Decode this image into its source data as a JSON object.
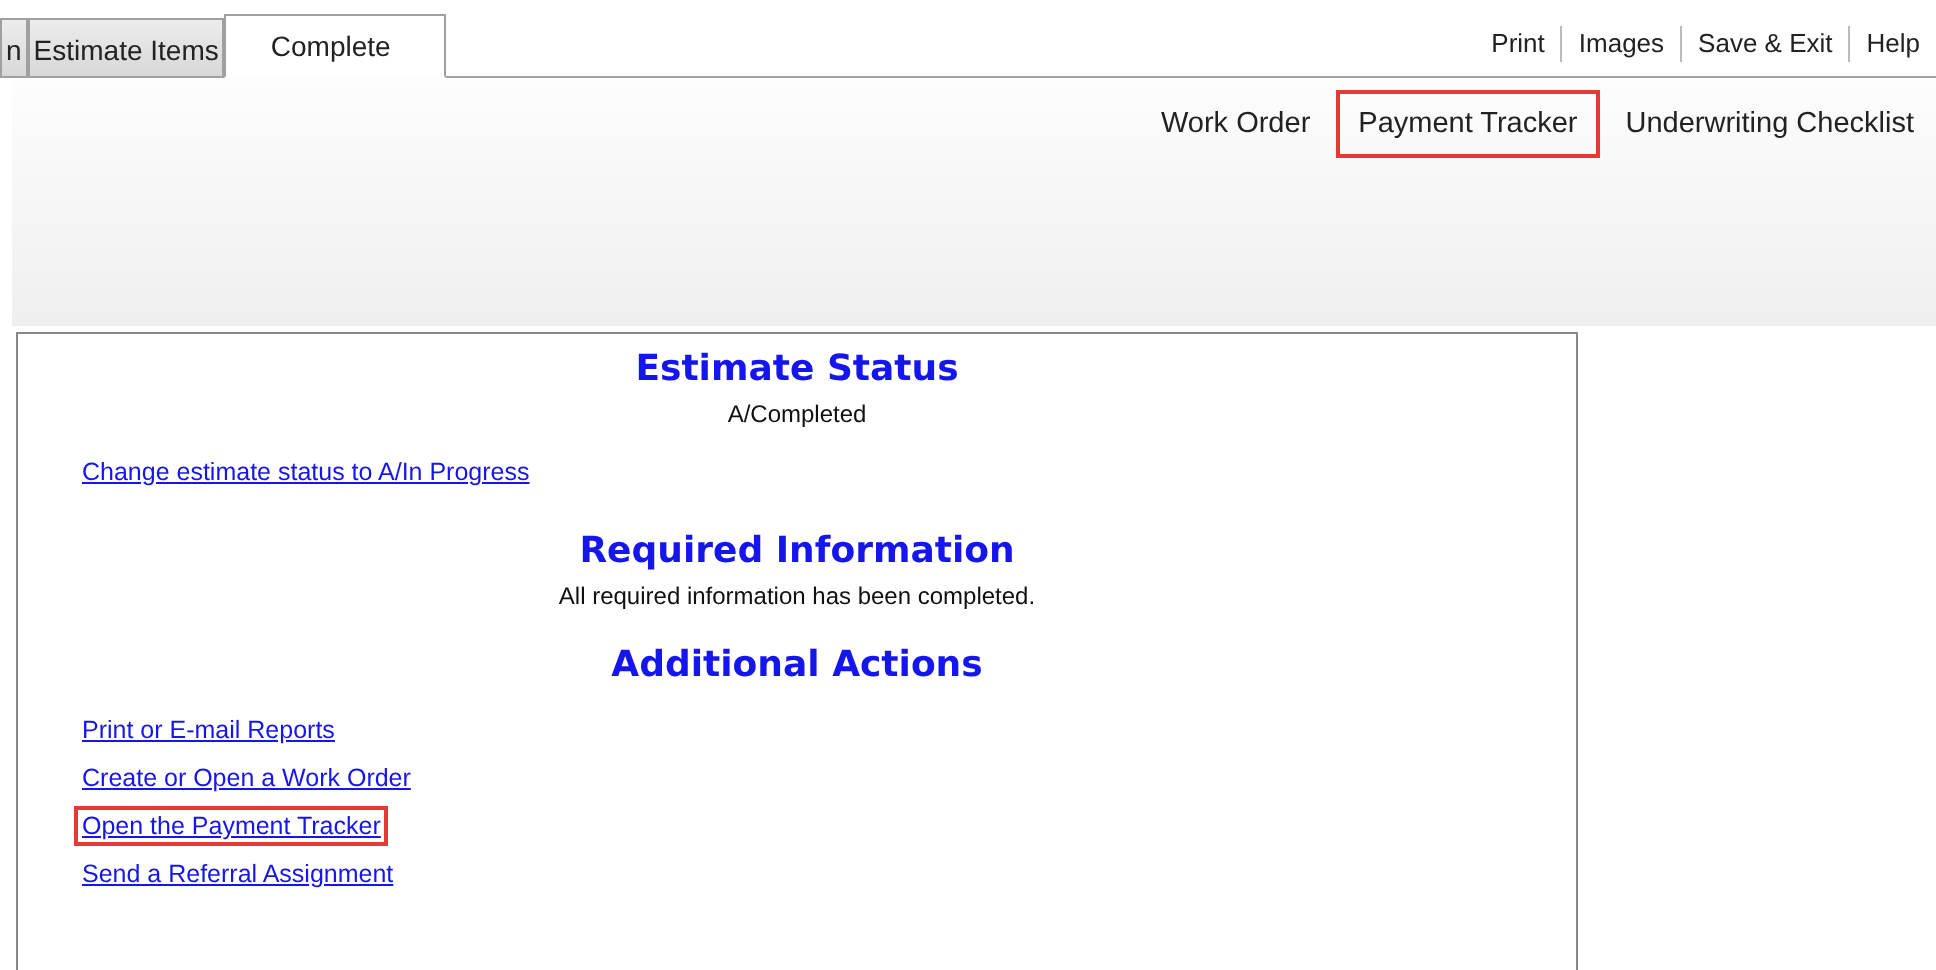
{
  "tabs": [
    {
      "label": "n",
      "selected": false
    },
    {
      "label": "Estimate Items",
      "selected": false
    },
    {
      "label": "Complete",
      "selected": true
    }
  ],
  "top_links": [
    "Print",
    "Images",
    "Save & Exit",
    "Help"
  ],
  "sub_links": [
    {
      "label": "Work Order",
      "highlighted": false
    },
    {
      "label": "Payment Tracker",
      "highlighted": true
    },
    {
      "label": "Underwriting Checklist",
      "highlighted": false
    }
  ],
  "sections": [
    {
      "title": "Estimate Status",
      "text": "A/Completed",
      "links": [
        {
          "label": "Change estimate status to A/In Progress",
          "highlighted": false
        }
      ]
    },
    {
      "title": "Required Information",
      "text": "All required information has been completed."
    },
    {
      "title": "Additional Actions",
      "links": [
        {
          "label": "Print or E-mail Reports",
          "highlighted": false
        },
        {
          "label": "Create or Open a Work Order",
          "highlighted": false
        },
        {
          "label": "Open the Payment Tracker",
          "highlighted": true
        },
        {
          "label": "Send a Referral Assignment",
          "highlighted": false
        }
      ]
    }
  ]
}
